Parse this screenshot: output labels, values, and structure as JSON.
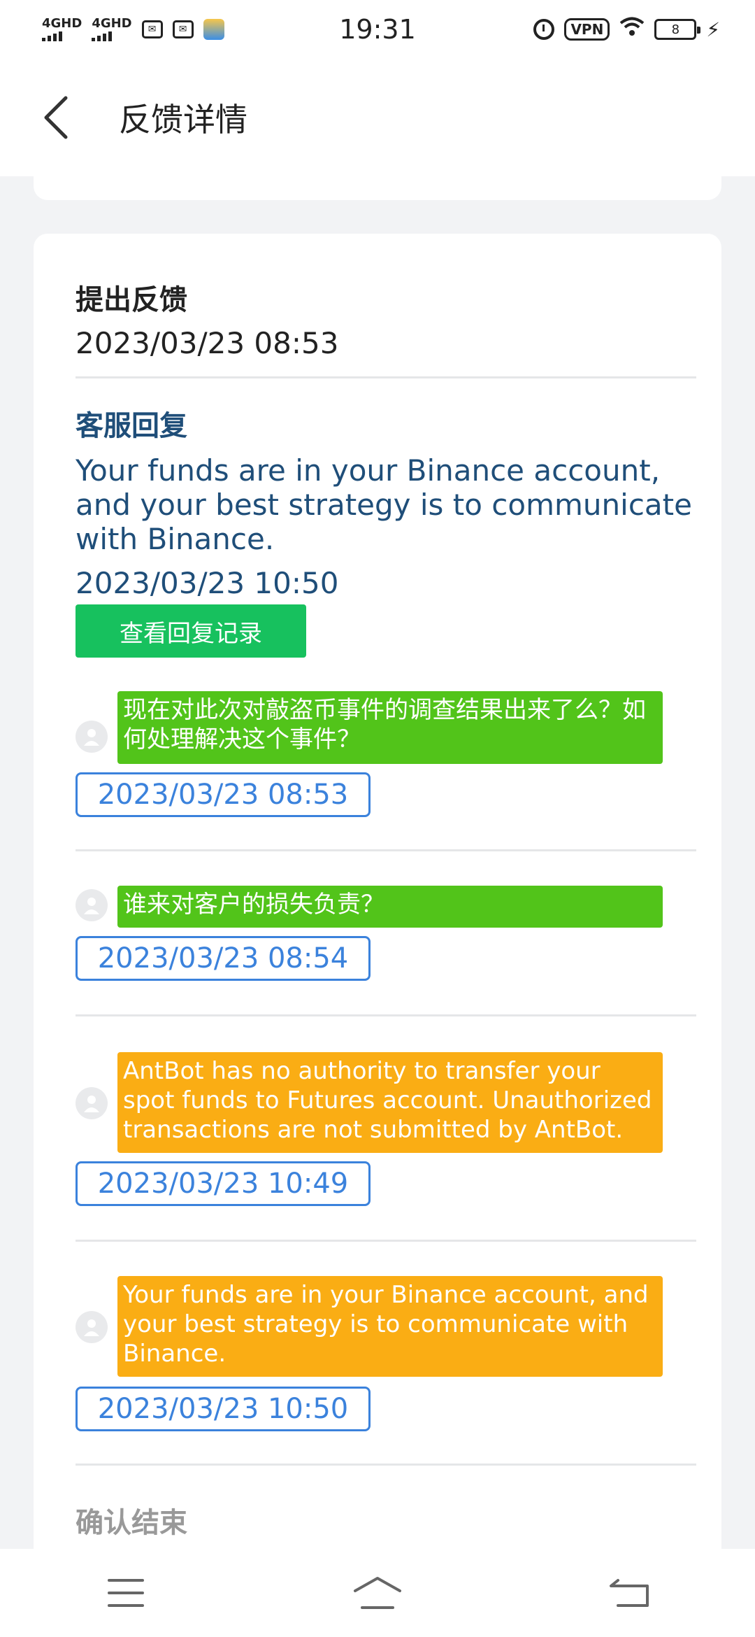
{
  "status_bar": {
    "time": "19:31",
    "network_1": "4GHD",
    "network_2": "4GHD",
    "vpn_label": "VPN",
    "battery_level": "8"
  },
  "header": {
    "title": "反馈详情"
  },
  "feedback": {
    "title": "提出反馈",
    "time": "2023/03/23 08:53"
  },
  "reply": {
    "title": "客服回复",
    "body": "Your funds are in your Binance account, and your best strategy is to communicate with Binance.",
    "time": "2023/03/23 10:50",
    "record_button": "查看回复记录"
  },
  "messages": [
    {
      "text": "现在对此次对敲盗币事件的调查结果出来了么？如何处理解决这个事件？",
      "time": "2023/03/23 08:53",
      "color": "#52c41a"
    },
    {
      "text": "谁来对客户的损失负责？",
      "time": "2023/03/23 08:54",
      "color": "#52c41a"
    },
    {
      "text": "AntBot has no authority to transfer your spot funds to Futures account. Unauthorized transactions are not submitted by AntBot.",
      "time": "2023/03/23 10:49",
      "color": "#faad14"
    },
    {
      "text": "Your funds are in your Binance account, and your best strategy is to communicate with Binance.",
      "time": "2023/03/23 10:50",
      "color": "#faad14"
    }
  ],
  "confirm": {
    "title": "确认结束"
  }
}
